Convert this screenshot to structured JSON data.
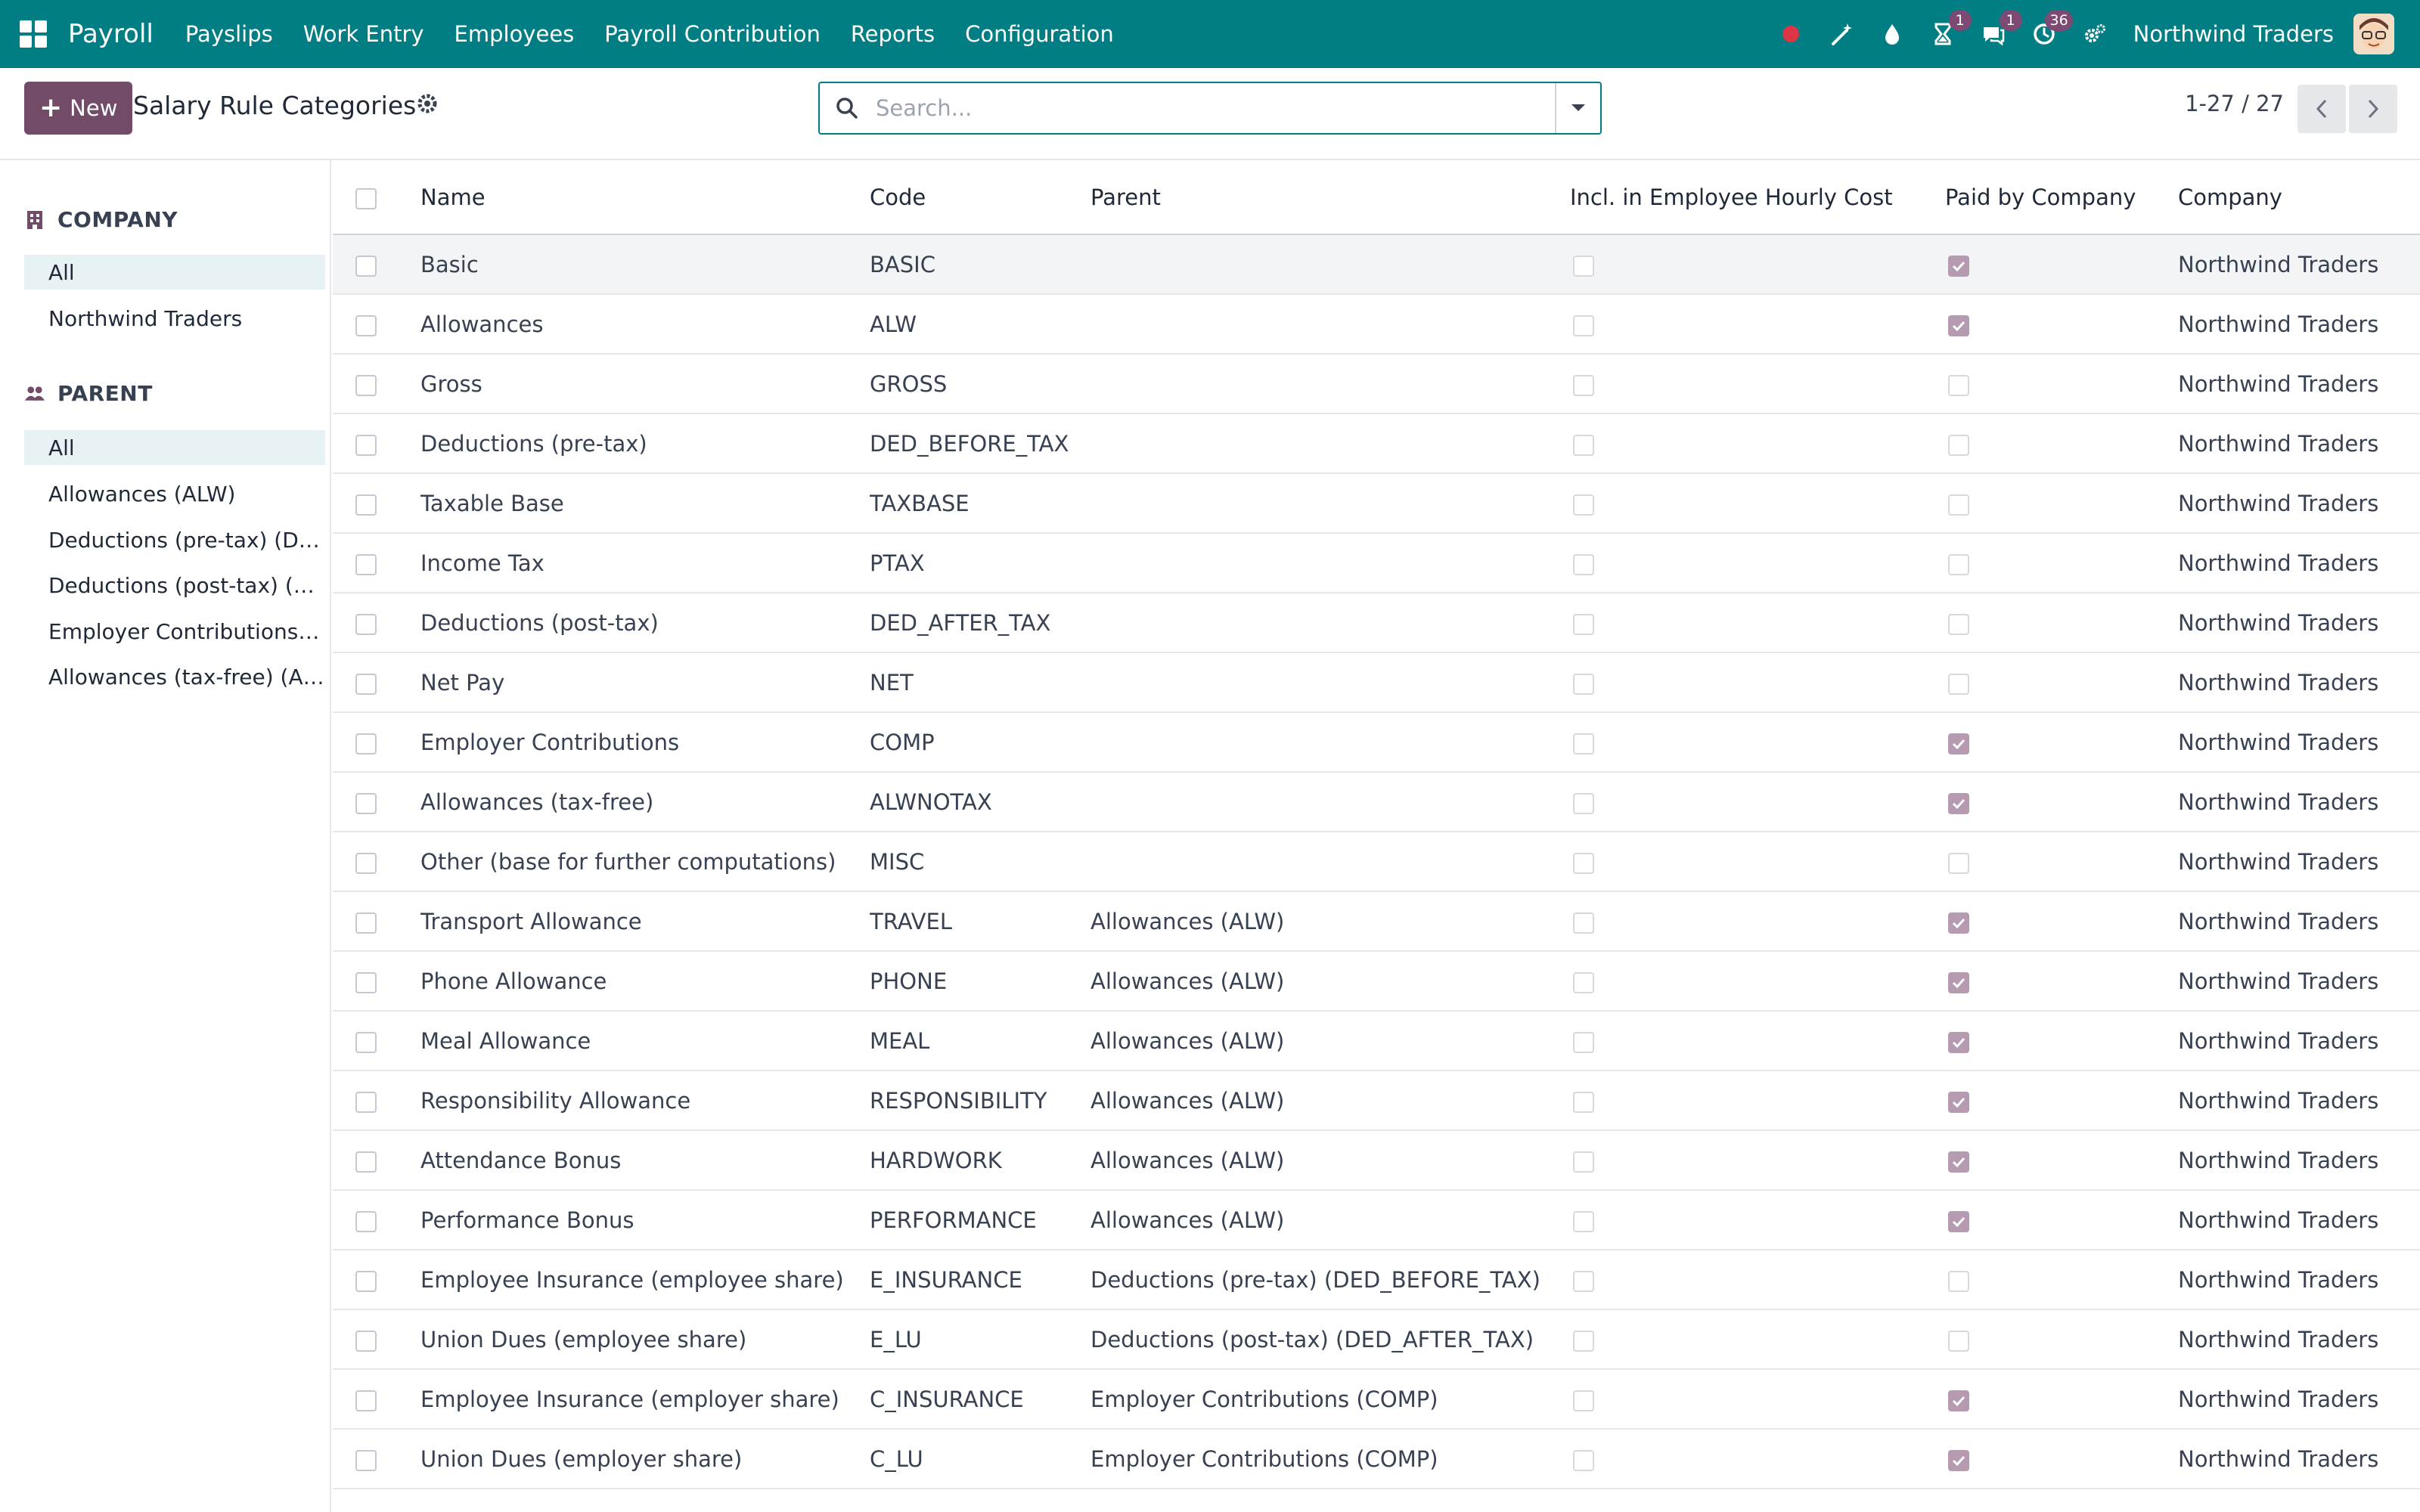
{
  "app": {
    "name": "Payroll",
    "menu": [
      "Payslips",
      "Work Entry",
      "Employees",
      "Payroll Contribution",
      "Reports",
      "Configuration"
    ],
    "company": "Northwind Traders",
    "badges": {
      "activity": "1",
      "messages": "1",
      "timeoff": "36"
    },
    "colors": {
      "brand": "#017e84",
      "primary": "#714b67",
      "badge": "#7c4a73",
      "status_dot": "#dc3545"
    }
  },
  "control": {
    "new_label": "New",
    "title": "Salary Rule Categories",
    "search_placeholder": "Search...",
    "pager": "1-27 / 27"
  },
  "sidebar": {
    "company": {
      "title": "COMPANY",
      "items": [
        "All",
        "Northwind Traders"
      ]
    },
    "parent": {
      "title": "PARENT",
      "items": [
        "All",
        "Allowances (ALW)",
        "Deductions (pre-tax) (DED_BEFORE_TAX)",
        "Deductions (post-tax) (DED_AFTER_TAX)",
        "Employer Contributions (COMP)",
        "Allowances (tax-free) (ALWNOTAX)"
      ]
    }
  },
  "table": {
    "columns": [
      "Name",
      "Code",
      "Parent",
      "Incl. in Employee Hourly Cost",
      "Paid by Company",
      "Company"
    ],
    "rows": [
      {
        "name": "Basic",
        "code": "BASIC",
        "parent": "",
        "incl": false,
        "paid": true,
        "company": "Northwind Traders"
      },
      {
        "name": "Allowances",
        "code": "ALW",
        "parent": "",
        "incl": false,
        "paid": true,
        "company": "Northwind Traders"
      },
      {
        "name": "Gross",
        "code": "GROSS",
        "parent": "",
        "incl": false,
        "paid": false,
        "company": "Northwind Traders"
      },
      {
        "name": "Deductions (pre-tax)",
        "code": "DED_BEFORE_TAX",
        "parent": "",
        "incl": false,
        "paid": false,
        "company": "Northwind Traders"
      },
      {
        "name": "Taxable Base",
        "code": "TAXBASE",
        "parent": "",
        "incl": false,
        "paid": false,
        "company": "Northwind Traders"
      },
      {
        "name": "Income Tax",
        "code": "PTAX",
        "parent": "",
        "incl": false,
        "paid": false,
        "company": "Northwind Traders"
      },
      {
        "name": "Deductions (post-tax)",
        "code": "DED_AFTER_TAX",
        "parent": "",
        "incl": false,
        "paid": false,
        "company": "Northwind Traders"
      },
      {
        "name": "Net Pay",
        "code": "NET",
        "parent": "",
        "incl": false,
        "paid": false,
        "company": "Northwind Traders"
      },
      {
        "name": "Employer Contributions",
        "code": "COMP",
        "parent": "",
        "incl": false,
        "paid": true,
        "company": "Northwind Traders"
      },
      {
        "name": "Allowances (tax-free)",
        "code": "ALWNOTAX",
        "parent": "",
        "incl": false,
        "paid": true,
        "company": "Northwind Traders"
      },
      {
        "name": "Other (base for further computations)",
        "code": "MISC",
        "parent": "",
        "incl": false,
        "paid": false,
        "company": "Northwind Traders"
      },
      {
        "name": "Transport Allowance",
        "code": "TRAVEL",
        "parent": "Allowances (ALW)",
        "incl": false,
        "paid": true,
        "company": "Northwind Traders"
      },
      {
        "name": "Phone Allowance",
        "code": "PHONE",
        "parent": "Allowances (ALW)",
        "incl": false,
        "paid": true,
        "company": "Northwind Traders"
      },
      {
        "name": "Meal Allowance",
        "code": "MEAL",
        "parent": "Allowances (ALW)",
        "incl": false,
        "paid": true,
        "company": "Northwind Traders"
      },
      {
        "name": "Responsibility Allowance",
        "code": "RESPONSIBILITY",
        "parent": "Allowances (ALW)",
        "incl": false,
        "paid": true,
        "company": "Northwind Traders"
      },
      {
        "name": "Attendance Bonus",
        "code": "HARDWORK",
        "parent": "Allowances (ALW)",
        "incl": false,
        "paid": true,
        "company": "Northwind Traders"
      },
      {
        "name": "Performance Bonus",
        "code": "PERFORMANCE",
        "parent": "Allowances (ALW)",
        "incl": false,
        "paid": true,
        "company": "Northwind Traders"
      },
      {
        "name": "Employee Insurance (employee share)",
        "code": "E_INSURANCE",
        "parent": "Deductions (pre-tax) (DED_BEFORE_TAX)",
        "incl": false,
        "paid": false,
        "company": "Northwind Traders"
      },
      {
        "name": "Union Dues (employee share)",
        "code": "E_LU",
        "parent": "Deductions (post-tax) (DED_AFTER_TAX)",
        "incl": false,
        "paid": false,
        "company": "Northwind Traders"
      },
      {
        "name": "Employee Insurance (employer share)",
        "code": "C_INSURANCE",
        "parent": "Employer Contributions (COMP)",
        "incl": false,
        "paid": true,
        "company": "Northwind Traders"
      },
      {
        "name": "Union Dues (employer share)",
        "code": "C_LU",
        "parent": "Employer Contributions (COMP)",
        "incl": false,
        "paid": true,
        "company": "Northwind Traders"
      }
    ]
  }
}
